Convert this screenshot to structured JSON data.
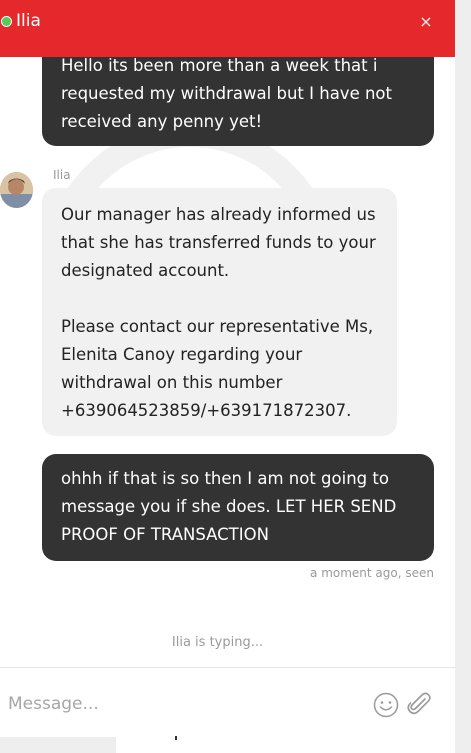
{
  "header": {
    "agent_name": "Ilia",
    "close_label": "×",
    "online_color": "#58c95a",
    "header_color": "#e5282c"
  },
  "messages": [
    {
      "direction": "outgoing",
      "text": "Hello its been more than a week that i\nrequested my withdrawal but I have not\nreceived any penny yet!"
    },
    {
      "direction": "incoming",
      "sender": "Ilia",
      "text": "Our manager has already informed us\nthat she has transferred funds to your\ndesignated account.\n\nPlease contact our representative Ms,\nElenita Canoy regarding your\nwithdrawal on this number\n+639064523859/+639171872307."
    },
    {
      "direction": "outgoing",
      "text": "ohhh if that is so then I am not going to\nmessage you if she does. LET HER SEND\nPROOF OF TRANSACTION"
    }
  ],
  "last_status": "a moment ago, seen",
  "typing_indicator": "Ilia is typing...",
  "composer": {
    "placeholder": "Message...",
    "value": "",
    "emoji_icon": "smiley-icon",
    "attach_icon": "paperclip-icon"
  }
}
